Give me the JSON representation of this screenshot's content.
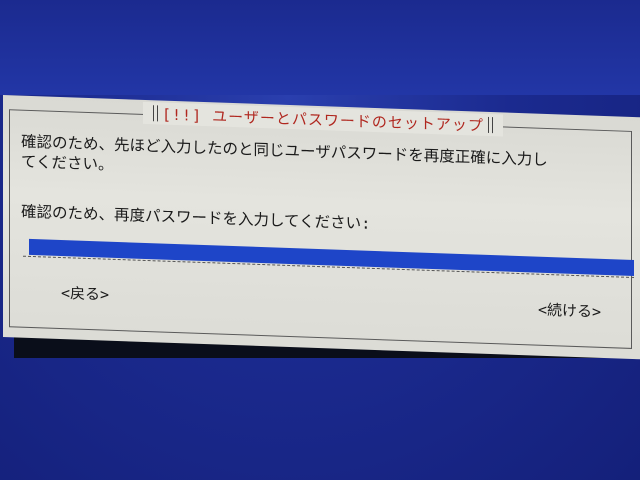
{
  "dialog": {
    "title": "[!!] ユーザーとパスワードのセットアップ",
    "message_line1": "確認のため、先ほど入力したのと同じユーザパスワードを再度正確に入力し",
    "message_line2": "てください。",
    "prompt": "確認のため、再度パスワードを入力してください:",
    "password_value": "",
    "back_label": "<戻る>",
    "continue_label": "<続ける>"
  },
  "colors": {
    "background": "#1b2a8f",
    "dialog": "#e4e4de",
    "title_text": "#b0271f",
    "input_field": "#1e45c8"
  }
}
